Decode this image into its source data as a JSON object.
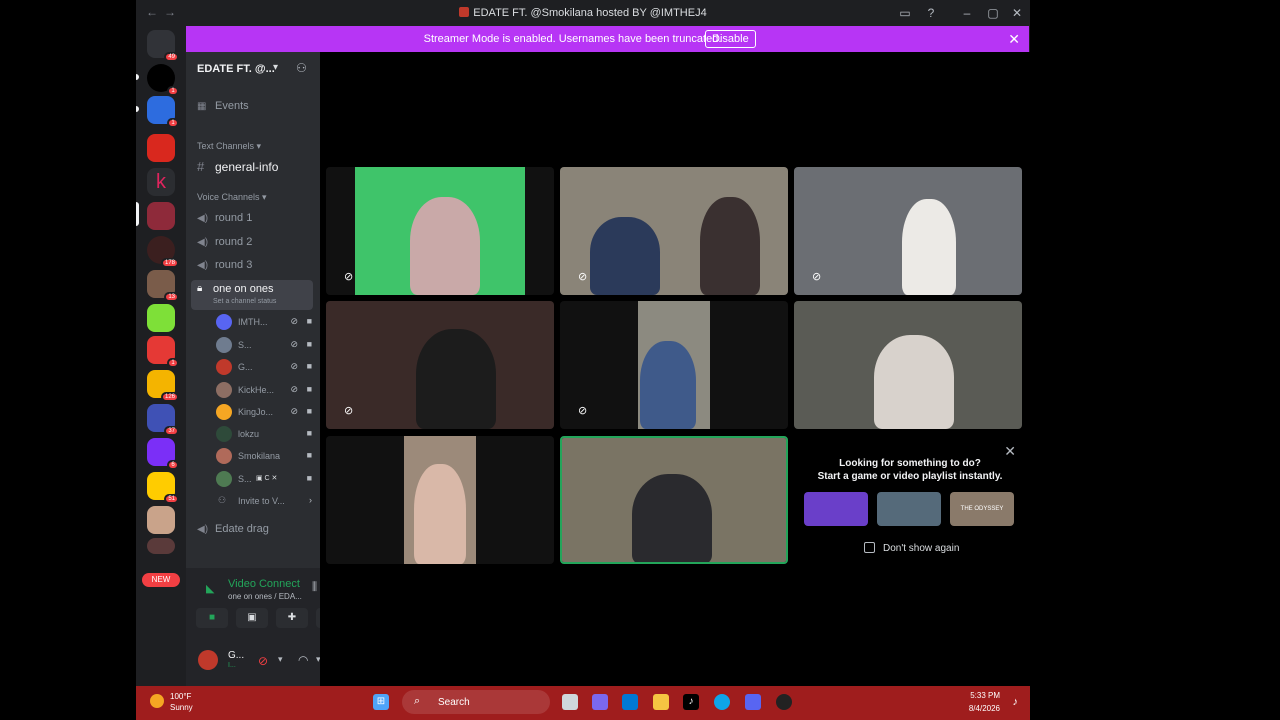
{
  "window": {
    "title": "EDATE FT. @Smokilana hosted BY @IMTHEJ4"
  },
  "banner": {
    "text": "Streamer Mode is enabled. Usernames have been truncated.",
    "button": "Disable"
  },
  "rail": {
    "badges": [
      "49",
      "1",
      "1",
      "178",
      "13",
      "1",
      "126",
      "37",
      "6",
      "51"
    ],
    "new_label": "NEW"
  },
  "sidebar": {
    "server_name": "EDATE FT. @...",
    "events": "Events",
    "text_category": "Text Channels",
    "text_channel": "general-info",
    "voice_category": "Voice Channels",
    "voice_channels": [
      "round 1",
      "round 2",
      "round 3"
    ],
    "active_channel": "one on ones",
    "active_status": "Set a channel status",
    "users": [
      "IMTH...",
      "S...",
      "G...",
      "KickHe...",
      "KingJo...",
      "lokzu",
      "Smokilana",
      "S...",
      "Invite to V..."
    ],
    "after_channel": "Edate drag"
  },
  "voice": {
    "status": "Video Connect",
    "sub": "one on ones / EDA..."
  },
  "user_panel": {
    "name": "G...",
    "status": "I..."
  },
  "stage": {
    "suggest_title": "Looking for something to do?",
    "suggest_sub": "Start a game or video playlist instantly.",
    "activities": [
      "",
      "",
      "THE ODYSSEY"
    ],
    "dont_show": "Don't show again"
  },
  "taskbar": {
    "temp": "100°F",
    "cond": "Sunny",
    "search": "Search",
    "time": "5:33 PM",
    "date": "8/4/2026"
  },
  "colors": {
    "accent": "#b735f5",
    "online": "#23a55a",
    "badge": "#f23f43",
    "taskbar": "#9f1d1d"
  }
}
